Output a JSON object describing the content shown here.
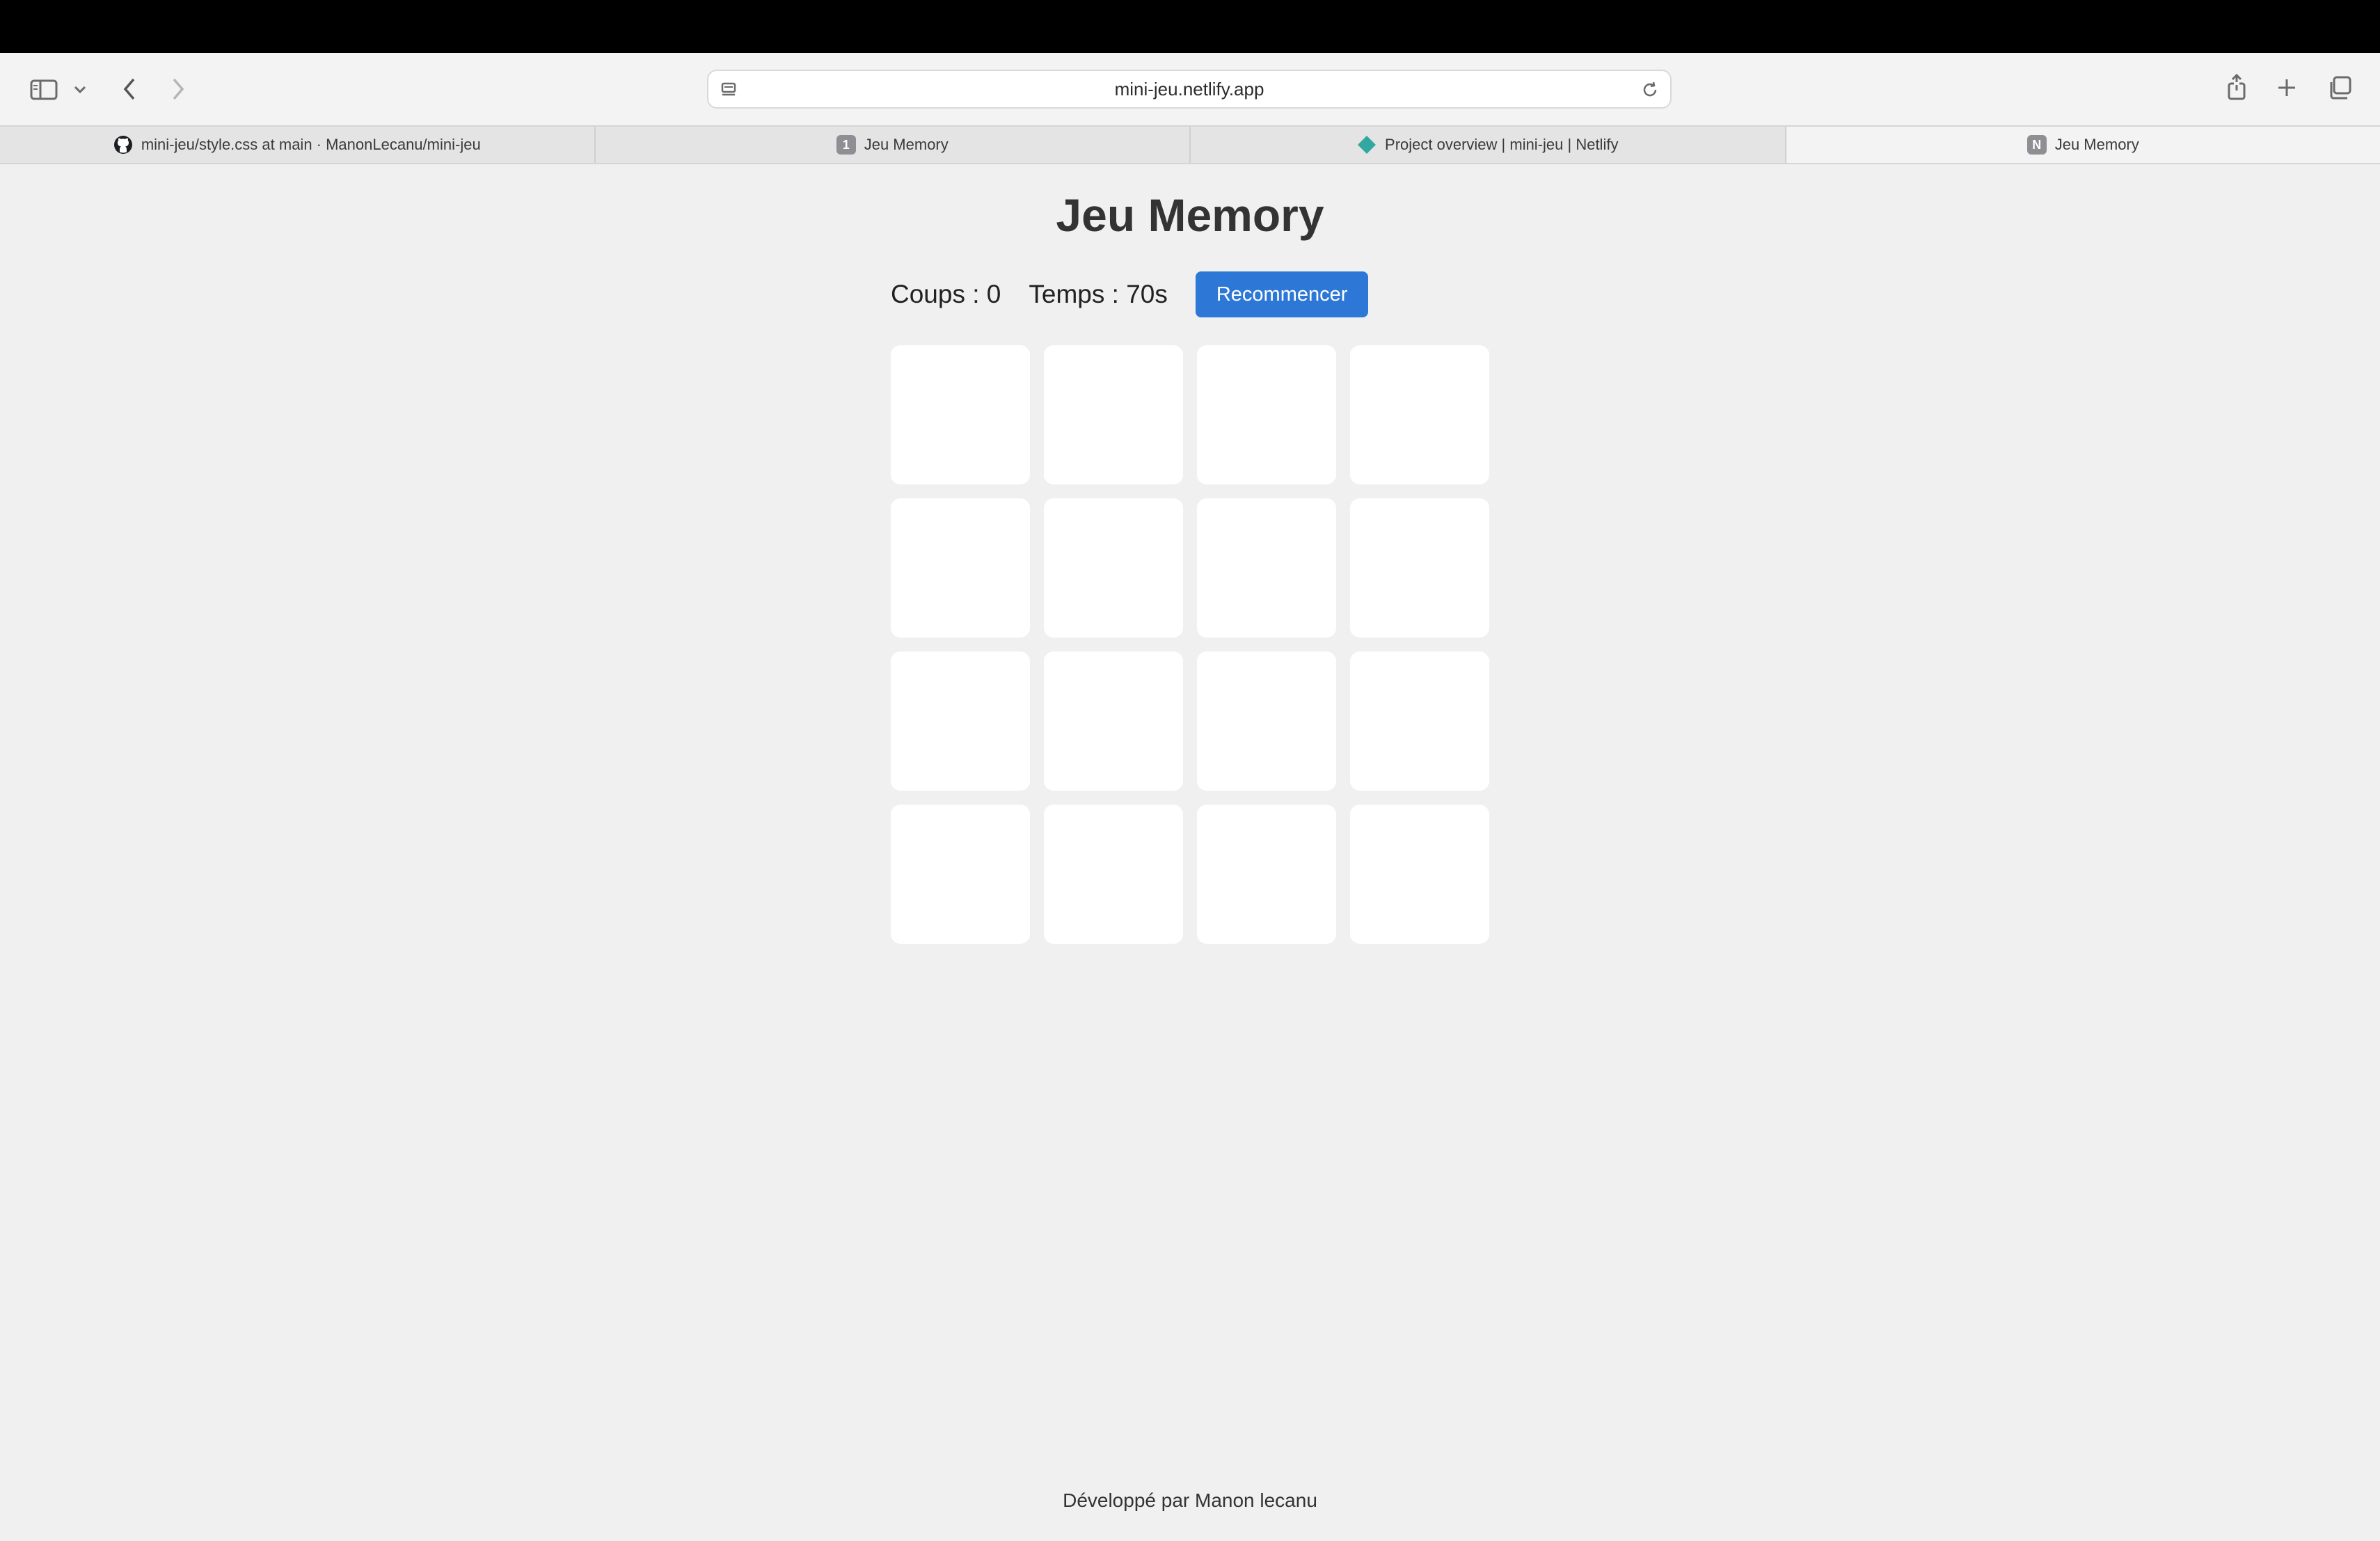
{
  "browser": {
    "url": "mini-jeu.netlify.app",
    "tabs": [
      {
        "label": "mini-jeu/style.css at main · ManonLecanu/mini-jeu",
        "favicon": "github-icon"
      },
      {
        "label": "Jeu Memory",
        "favicon": "badge",
        "badge": "1"
      },
      {
        "label": "Project overview | mini-jeu | Netlify",
        "favicon": "netlify-icon"
      },
      {
        "label": "Jeu Memory",
        "favicon": "badge",
        "badge": "N"
      }
    ],
    "active_tab": 3
  },
  "game": {
    "title": "Jeu Memory",
    "moves_text": "Coups : 0",
    "time_text": "Temps : 70s",
    "restart_label": "Recommencer",
    "grid": {
      "rows": 4,
      "columns": 4,
      "face_down_cards": 16
    }
  },
  "footer": {
    "text": "Développé par Manon lecanu"
  },
  "colors": {
    "page_background": "#f0f0f0",
    "card": "#ffffff",
    "button": "#2d78d6",
    "title": "#333333"
  }
}
